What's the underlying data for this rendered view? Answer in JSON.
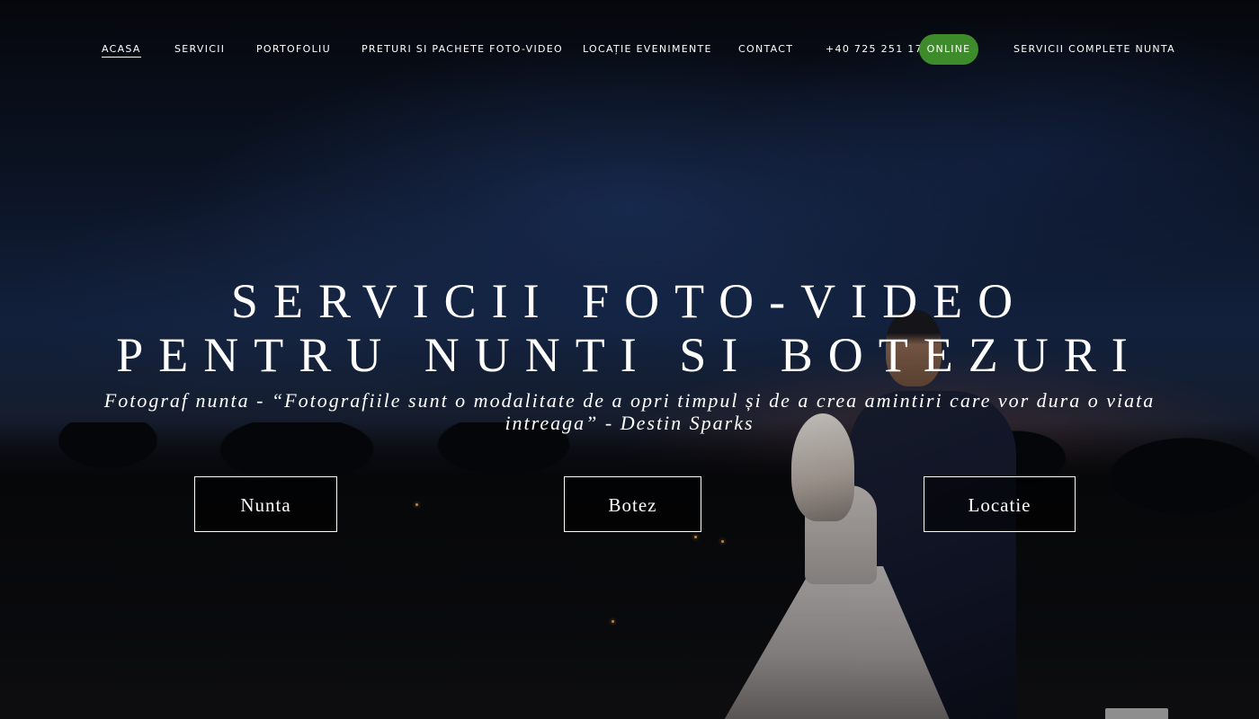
{
  "nav": {
    "items": [
      {
        "label": "ACASA",
        "active": true
      },
      {
        "label": "SERVICII"
      },
      {
        "label": "PORTOFOLIU"
      },
      {
        "label": "PRETURI SI PACHETE FOTO-VIDEO"
      },
      {
        "label": "LOCAȚIE EVENIMENTE"
      },
      {
        "label": "CONTACT"
      },
      {
        "label": "+40 725 251 175"
      },
      {
        "label": "SERVICII COMPLETE NUNTA"
      }
    ],
    "online_badge": "ONLINE",
    "online_color": "#3d8b2a"
  },
  "hero": {
    "headline_line1": "SERVICII FOTO-VIDEO",
    "headline_line2": "PENTRU NUNTI SI BOTEZURI",
    "tagline": "Fotograf nunta - “Fotografiile sunt o modalitate de a opri timpul și de a crea amintiri care vor dura o viata intreaga” - Destin Sparks",
    "buttons": [
      {
        "label": "Nunta"
      },
      {
        "label": "Botez"
      },
      {
        "label": "Locatie"
      }
    ]
  }
}
